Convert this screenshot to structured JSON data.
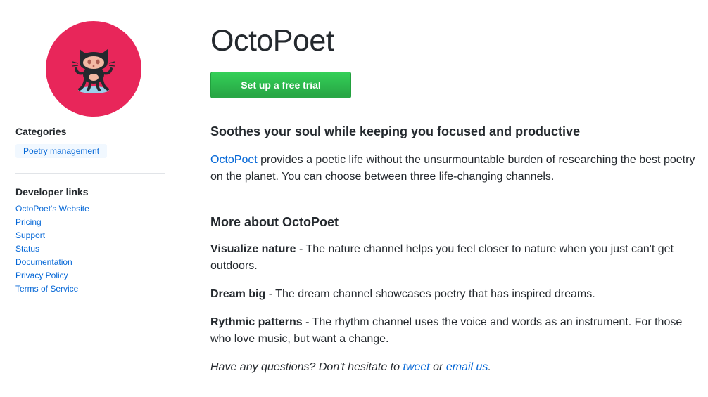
{
  "sidebar": {
    "logo_alt": "OctoPoet logo",
    "categories_heading": "Categories",
    "category_tag": "Poetry management",
    "developer_heading": "Developer links",
    "developer_links": [
      "OctoPoet's Website",
      "Pricing",
      "Support",
      "Status",
      "Documentation",
      "Privacy Policy",
      "Terms of Service"
    ]
  },
  "main": {
    "title": "OctoPoet",
    "cta_label": "Set up a free trial",
    "tagline_heading": "Soothes your soul while keeping you focused and productive",
    "intro_link": "OctoPoet",
    "intro_text": " provides a poetic life without the unsurmountable burden of researching the best poetry on the planet. You can choose between three life-changing channels.",
    "more_heading": "More about OctoPoet",
    "features": [
      {
        "name": "Visualize nature",
        "text": " - The nature channel helps you feel closer to nature when you just can't get outdoors."
      },
      {
        "name": "Dream big",
        "text": " - The dream channel showcases poetry that has inspired dreams."
      },
      {
        "name": "Rythmic patterns",
        "text": " - The rhythm channel uses the voice and words as an instrument. For those who love music, but want a change."
      }
    ],
    "closing_prefix": "Have any questions? Don't hesitate to ",
    "closing_tweet": "tweet",
    "closing_or": " or ",
    "closing_email": "email us",
    "closing_suffix": "."
  },
  "colors": {
    "logo_background": "#e8265a",
    "link": "#0366d6",
    "cta_green": "#28a745",
    "tag_background": "#f1f8ff"
  },
  "icons": {
    "logo": "octocat-icon"
  }
}
